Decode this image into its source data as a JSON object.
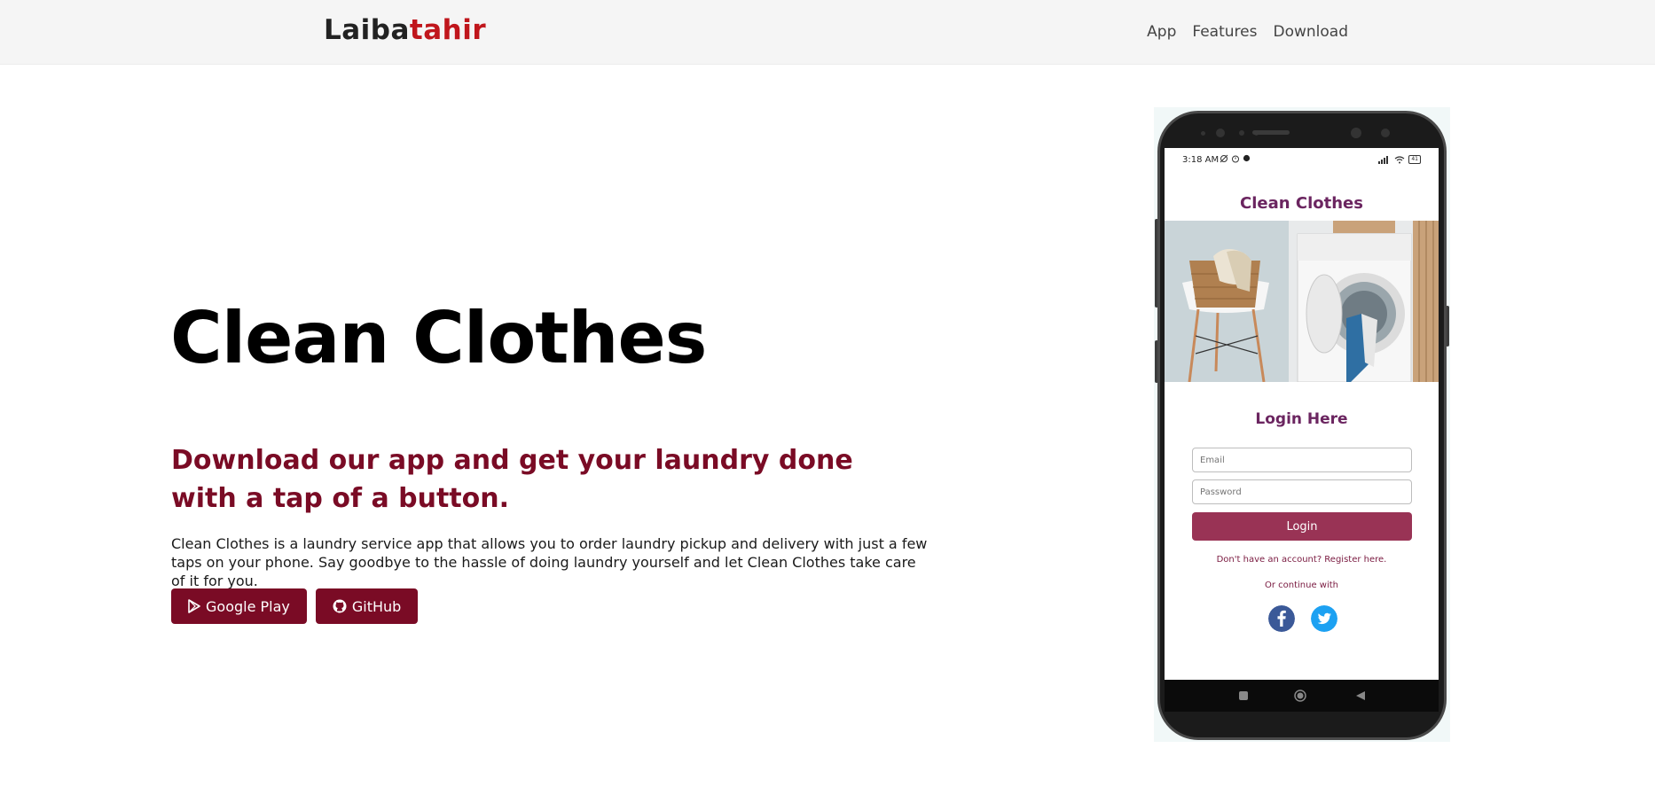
{
  "navbar": {
    "brand_part1": "Laiba",
    "brand_part2": "tahir",
    "links": [
      "App",
      "Features",
      "Download"
    ]
  },
  "hero": {
    "title": "Clean Clothes",
    "subtitle": "Download our app and get your laundry done with a tap of a button.",
    "description": "Clean Clothes is a laundry service app that allows you to order laundry pickup and delivery with just a few taps on your phone. Say goodbye to the hassle of doing laundry yourself and let Clean Clothes take care of it for you.",
    "buttons": {
      "google_play": "Google Play",
      "github": "GitHub"
    }
  },
  "phone": {
    "status_time": "3:18 AM",
    "battery": "41",
    "app_title": "Clean Clothes",
    "login_title": "Login Here",
    "email_placeholder": "Email",
    "password_placeholder": "Password",
    "login_button": "Login",
    "register_link": "Don't have an account? Register here.",
    "continue_text": "Or continue with"
  },
  "colors": {
    "brand_red": "#c0161c",
    "accent_maroon": "#7a0b25",
    "app_purple": "#6b2560",
    "login_button": "#993355"
  }
}
